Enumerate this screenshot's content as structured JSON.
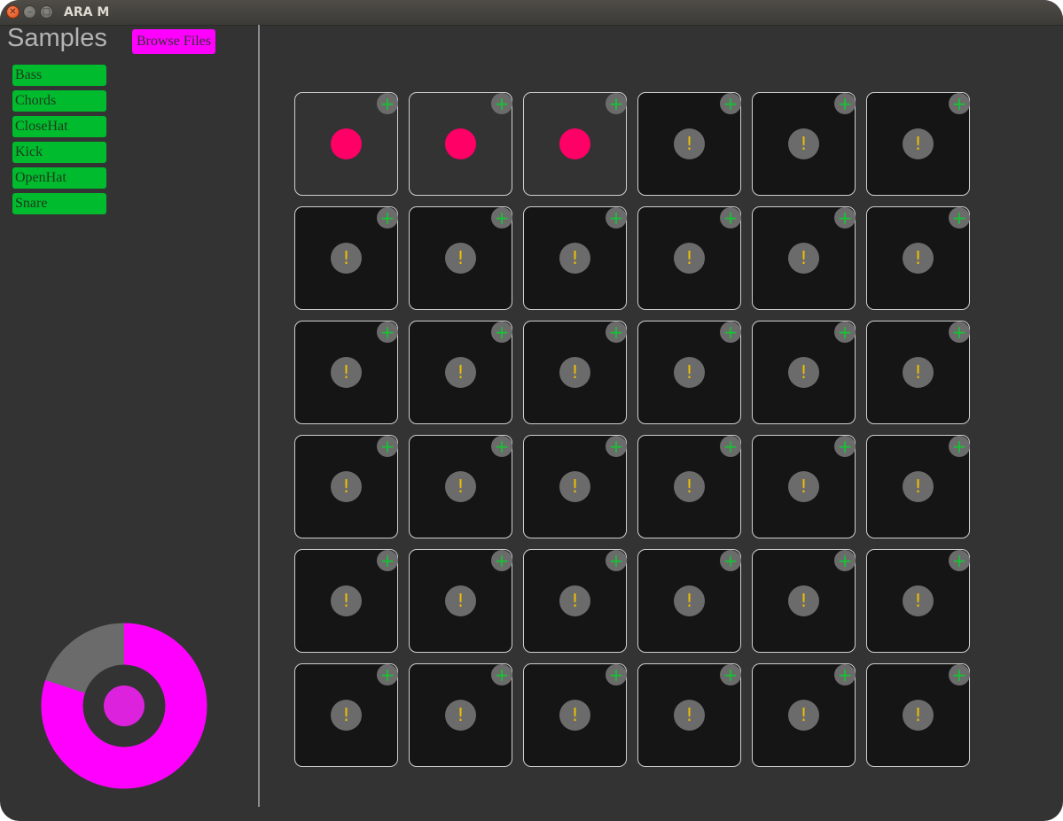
{
  "window": {
    "title": "ARA M"
  },
  "sidebar": {
    "title": "Samples",
    "browse_label": "Browse Files",
    "samples": [
      "Bass",
      "Chords",
      "CloseHat",
      "Kick",
      "OpenHat",
      "Snare"
    ]
  },
  "pads": [
    {
      "status": "loaded"
    },
    {
      "status": "loaded"
    },
    {
      "status": "loaded"
    },
    {
      "status": "empty"
    },
    {
      "status": "empty"
    },
    {
      "status": "empty"
    },
    {
      "status": "empty"
    },
    {
      "status": "empty"
    },
    {
      "status": "empty"
    },
    {
      "status": "empty"
    },
    {
      "status": "empty"
    },
    {
      "status": "empty"
    },
    {
      "status": "empty"
    },
    {
      "status": "empty"
    },
    {
      "status": "empty"
    },
    {
      "status": "empty"
    },
    {
      "status": "empty"
    },
    {
      "status": "empty"
    },
    {
      "status": "empty"
    },
    {
      "status": "empty"
    },
    {
      "status": "empty"
    },
    {
      "status": "empty"
    },
    {
      "status": "empty"
    },
    {
      "status": "empty"
    },
    {
      "status": "empty"
    },
    {
      "status": "empty"
    },
    {
      "status": "empty"
    },
    {
      "status": "empty"
    },
    {
      "status": "empty"
    },
    {
      "status": "empty"
    },
    {
      "status": "empty"
    },
    {
      "status": "empty"
    },
    {
      "status": "empty"
    },
    {
      "status": "empty"
    },
    {
      "status": "empty"
    },
    {
      "status": "empty"
    }
  ],
  "pad_glyphs": {
    "add": "+",
    "empty": "!"
  },
  "icons": {
    "add": "plus-icon",
    "empty": "warning-icon",
    "loaded": "dot-icon"
  },
  "meter": {
    "fraction": 0.8,
    "colors": {
      "fill": "#ff00ff",
      "track": "#6b6b6b",
      "center": "#dd22dd"
    }
  },
  "colors": {
    "accent": "#ff00ff",
    "sample": "#00bb2d",
    "loaded_dot": "#ff0066",
    "warning": "#f0c000",
    "add": "#15c534"
  }
}
